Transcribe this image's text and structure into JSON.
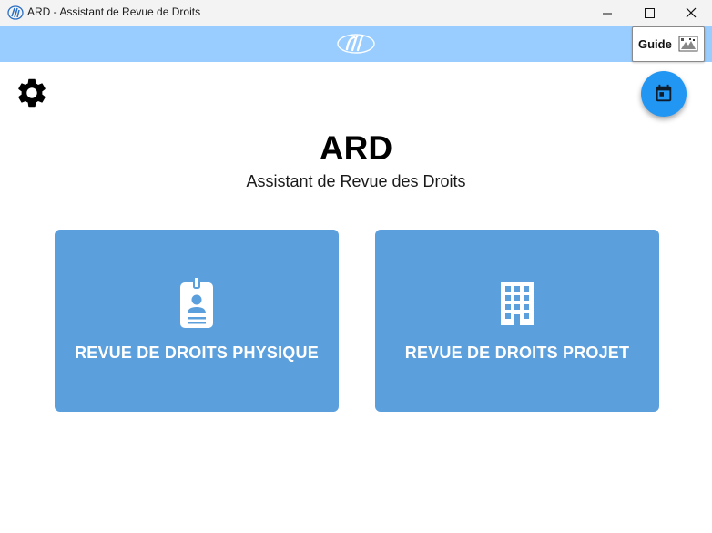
{
  "window": {
    "title": "ARD - Assistant de Revue de Droits"
  },
  "header": {
    "logo_icon": "sii-logo",
    "guide_label": "Guide"
  },
  "toolbar": {
    "settings_icon": "gear-icon",
    "calendar_icon": "calendar-icon"
  },
  "main": {
    "title": "ARD",
    "subtitle": "Assistant de Revue des Droits",
    "cards": [
      {
        "label": "REVUE DE DROITS PHYSIQUE",
        "icon": "badge-icon"
      },
      {
        "label": "REVUE DE DROITS PROJET",
        "icon": "building-icon"
      }
    ]
  },
  "colors": {
    "header": "#99cdff",
    "card": "#5b9fdd",
    "fab": "#2196f3"
  }
}
